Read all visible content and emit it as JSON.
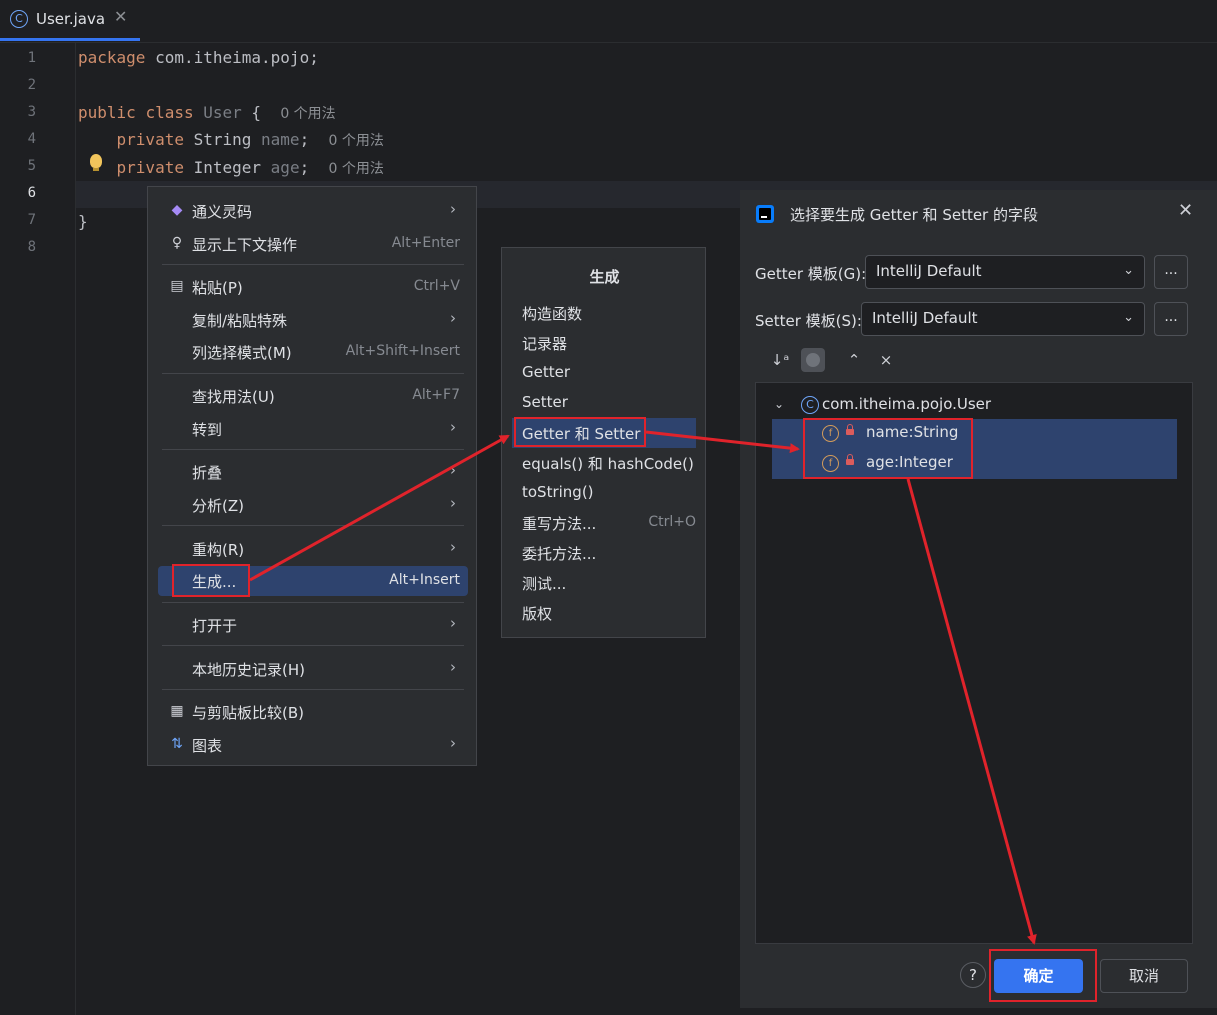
{
  "tab": {
    "title": "User.java",
    "icon_letter": "C",
    "close": "✕"
  },
  "gutter": {
    "lines": [
      "1",
      "2",
      "3",
      "4",
      "5",
      "6",
      "7",
      "8"
    ]
  },
  "code": {
    "line1": {
      "kw": "package",
      "rest": " com.itheima.pojo;"
    },
    "line3": {
      "kw1": "public",
      "kw2": "class",
      "name": "User",
      "brace": " {",
      "hint": "0 个用法"
    },
    "line4": {
      "kw": "private",
      "type": " String ",
      "field": "name",
      "semi": ";",
      "hint": "0 个用法"
    },
    "line5": {
      "kw": "private",
      "type": " Integer ",
      "field": "age",
      "semi": ";",
      "hint": "0 个用法"
    },
    "line7": "}"
  },
  "context_menu": {
    "items": [
      {
        "icon": "◆",
        "label": "通义灵码",
        "shortcut": "",
        "submenu": true
      },
      {
        "icon": "♀",
        "label": "显示上下文操作",
        "shortcut": "Alt+Enter",
        "submenu": false
      },
      {
        "icon": "▤",
        "label": "粘贴(P)",
        "shortcut": "Ctrl+V",
        "submenu": false
      },
      {
        "icon": "",
        "label": "复制/粘贴特殊",
        "shortcut": "",
        "submenu": true
      },
      {
        "icon": "",
        "label": "列选择模式(M)",
        "shortcut": "Alt+Shift+Insert",
        "submenu": false
      },
      {
        "icon": "",
        "label": "查找用法(U)",
        "shortcut": "Alt+F7",
        "submenu": false
      },
      {
        "icon": "",
        "label": "转到",
        "shortcut": "",
        "submenu": true
      },
      {
        "icon": "",
        "label": "折叠",
        "shortcut": "",
        "submenu": true
      },
      {
        "icon": "",
        "label": "分析(Z)",
        "shortcut": "",
        "submenu": true
      },
      {
        "icon": "",
        "label": "重构(R)",
        "shortcut": "",
        "submenu": true
      },
      {
        "icon": "",
        "label": "生成...",
        "shortcut": "Alt+Insert",
        "submenu": false
      },
      {
        "icon": "",
        "label": "打开于",
        "shortcut": "",
        "submenu": true
      },
      {
        "icon": "",
        "label": "本地历史记录(H)",
        "shortcut": "",
        "submenu": true
      },
      {
        "icon": "▦",
        "label": "与剪贴板比较(B)",
        "shortcut": "",
        "submenu": false
      },
      {
        "icon": "⇅",
        "label": "图表",
        "shortcut": "",
        "submenu": true
      }
    ]
  },
  "generate_menu": {
    "title": "生成",
    "items": [
      {
        "label": "构造函数",
        "shortcut": ""
      },
      {
        "label": "记录器",
        "shortcut": ""
      },
      {
        "label": "Getter",
        "shortcut": ""
      },
      {
        "label": "Setter",
        "shortcut": ""
      },
      {
        "label": "Getter 和 Setter",
        "shortcut": ""
      },
      {
        "label": "equals() 和 hashCode()",
        "shortcut": ""
      },
      {
        "label": "toString()",
        "shortcut": ""
      },
      {
        "label": "重写方法...",
        "shortcut": "Ctrl+O"
      },
      {
        "label": "委托方法...",
        "shortcut": ""
      },
      {
        "label": "测试...",
        "shortcut": ""
      },
      {
        "label": "版权",
        "shortcut": ""
      }
    ]
  },
  "dialog": {
    "title": "选择要生成 Getter 和 Setter 的字段",
    "close": "✕",
    "getter_label": "Getter 模板(G):",
    "getter_value": "IntelliJ Default",
    "setter_label": "Setter 模板(S):",
    "setter_value": "IntelliJ Default",
    "more": "...",
    "tree_root": "com.itheima.pojo.User",
    "fields": [
      "name:String",
      "age:Integer"
    ],
    "field_icon_letter": "f",
    "help": "?",
    "ok": "确定",
    "cancel": "取消"
  },
  "colors": {
    "accent": "#3574f0",
    "selection": "#2e436e",
    "annotation": "#e0232b"
  }
}
